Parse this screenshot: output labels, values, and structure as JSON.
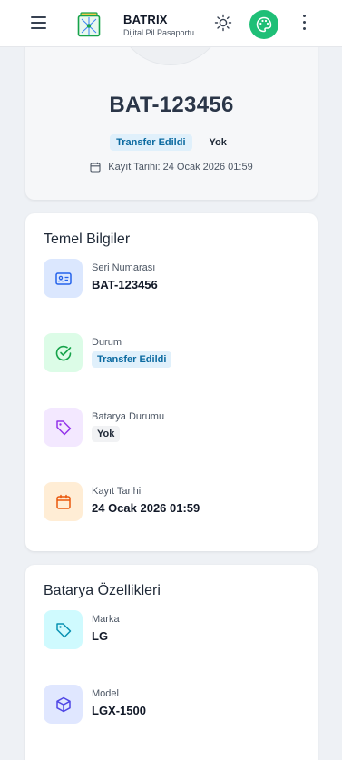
{
  "header": {
    "brand_name": "BATRIX",
    "brand_subtitle": "Dijital Pil Pasaportu",
    "icons": [
      "menu-icon",
      "batrix-logo",
      "sun-icon",
      "palette-icon",
      "more-vertical-icon"
    ],
    "accent_color": "#1fbf77"
  },
  "hero": {
    "title": "BAT-123456",
    "status_badge": "Transfer Edildi",
    "condition_text": "Yok",
    "registered_text": "Kayıt Tarihi: 24 Ocak 2026 01:59"
  },
  "basic_info": {
    "title": "Temel Bilgiler",
    "items": [
      {
        "label": "Seri Numarası",
        "value": "BAT-123456",
        "icon": "id-card-icon",
        "color": "#2563eb"
      },
      {
        "label": "Durum",
        "value": "Transfer Edildi",
        "icon": "check-circle-icon",
        "color": "#16a34a"
      },
      {
        "label": "Batarya Durumu",
        "value": "Yok",
        "icon": "tag-icon",
        "color": "#9333ea"
      },
      {
        "label": "Kayıt Tarihi",
        "value": "24 Ocak 2026 01:59",
        "icon": "calendar-icon",
        "color": "#ea580c"
      }
    ]
  },
  "specs": {
    "title": "Batarya Özellikleri",
    "items": [
      {
        "label": "Marka",
        "value": "LG",
        "icon": "tag-icon",
        "color": "#0891b2"
      },
      {
        "label": "Model",
        "value": "LGX-1500",
        "icon": "cube-icon",
        "color": "#4f46e5"
      }
    ]
  }
}
